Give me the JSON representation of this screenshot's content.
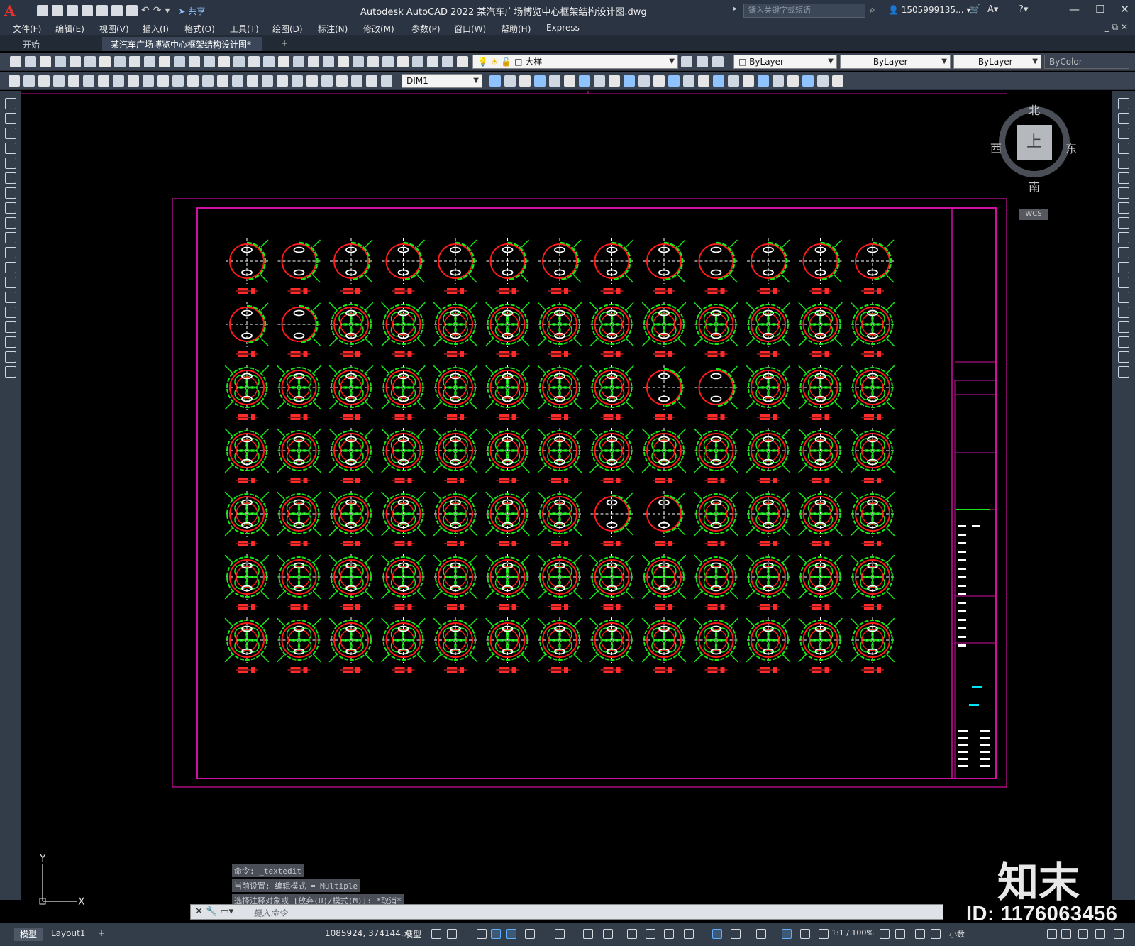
{
  "app": {
    "logo": "A",
    "title": "Autodesk AutoCAD 2022    某汽车广场博览中心框架结构设计图.dwg",
    "share_label": "共享",
    "search_placeholder": "键入关键字或短语",
    "user": "1505999135...",
    "window_controls": [
      "minimize-icon",
      "restore-icon",
      "close-icon"
    ]
  },
  "menu": [
    {
      "label": "文件(F)"
    },
    {
      "label": "编辑(E)"
    },
    {
      "label": "视图(V)"
    },
    {
      "label": "插入(I)"
    },
    {
      "label": "格式(O)"
    },
    {
      "label": "工具(T)"
    },
    {
      "label": "绘图(D)"
    },
    {
      "label": "标注(N)"
    },
    {
      "label": "修改(M)"
    },
    {
      "label": "参数(P)"
    },
    {
      "label": "窗口(W)"
    },
    {
      "label": "帮助(H)"
    },
    {
      "label": "Express"
    }
  ],
  "tabs": {
    "start": "开始",
    "document": "某汽车广场博览中心框架结构设计图*",
    "close_glyph": "×",
    "add_glyph": "+"
  },
  "toolbar": {
    "layer": "大样",
    "color": "ByLayer",
    "linetype": "ByLayer",
    "lineweight": "ByLayer",
    "plotstyle": "ByColor",
    "dimstyle": "DIM1"
  },
  "viewcube": {
    "north": "北",
    "south": "南",
    "east": "东",
    "west": "西",
    "face": "上",
    "wcs": "WCS"
  },
  "ucs": {
    "x_label": "X",
    "y_label": "Y"
  },
  "command": {
    "history": [
      "命令:  _textedit",
      "当前设置: 编辑模式 = Multiple",
      "选择注释对象或 [放弃(U)/模式(M)]: *取消*"
    ],
    "placeholder": "键入命令"
  },
  "status": {
    "layout_tabs": [
      "模型",
      "Layout1"
    ],
    "add_tab": "+",
    "coordinates": "1085924, 374144, 0",
    "mode": "模型",
    "scale": "1:1 / 100%",
    "units": "小数"
  },
  "watermark": {
    "brand": "知末",
    "id": "ID: 1176063456"
  },
  "colors": {
    "frame": "#d010a0",
    "column": "#ff1a1a",
    "rebar": "#19e619",
    "label": "#ff2a2a",
    "centerline": "#ffffff",
    "highlight": "#00e5ff"
  },
  "drawing": {
    "grid_rows": 7,
    "grid_cols": 13
  }
}
